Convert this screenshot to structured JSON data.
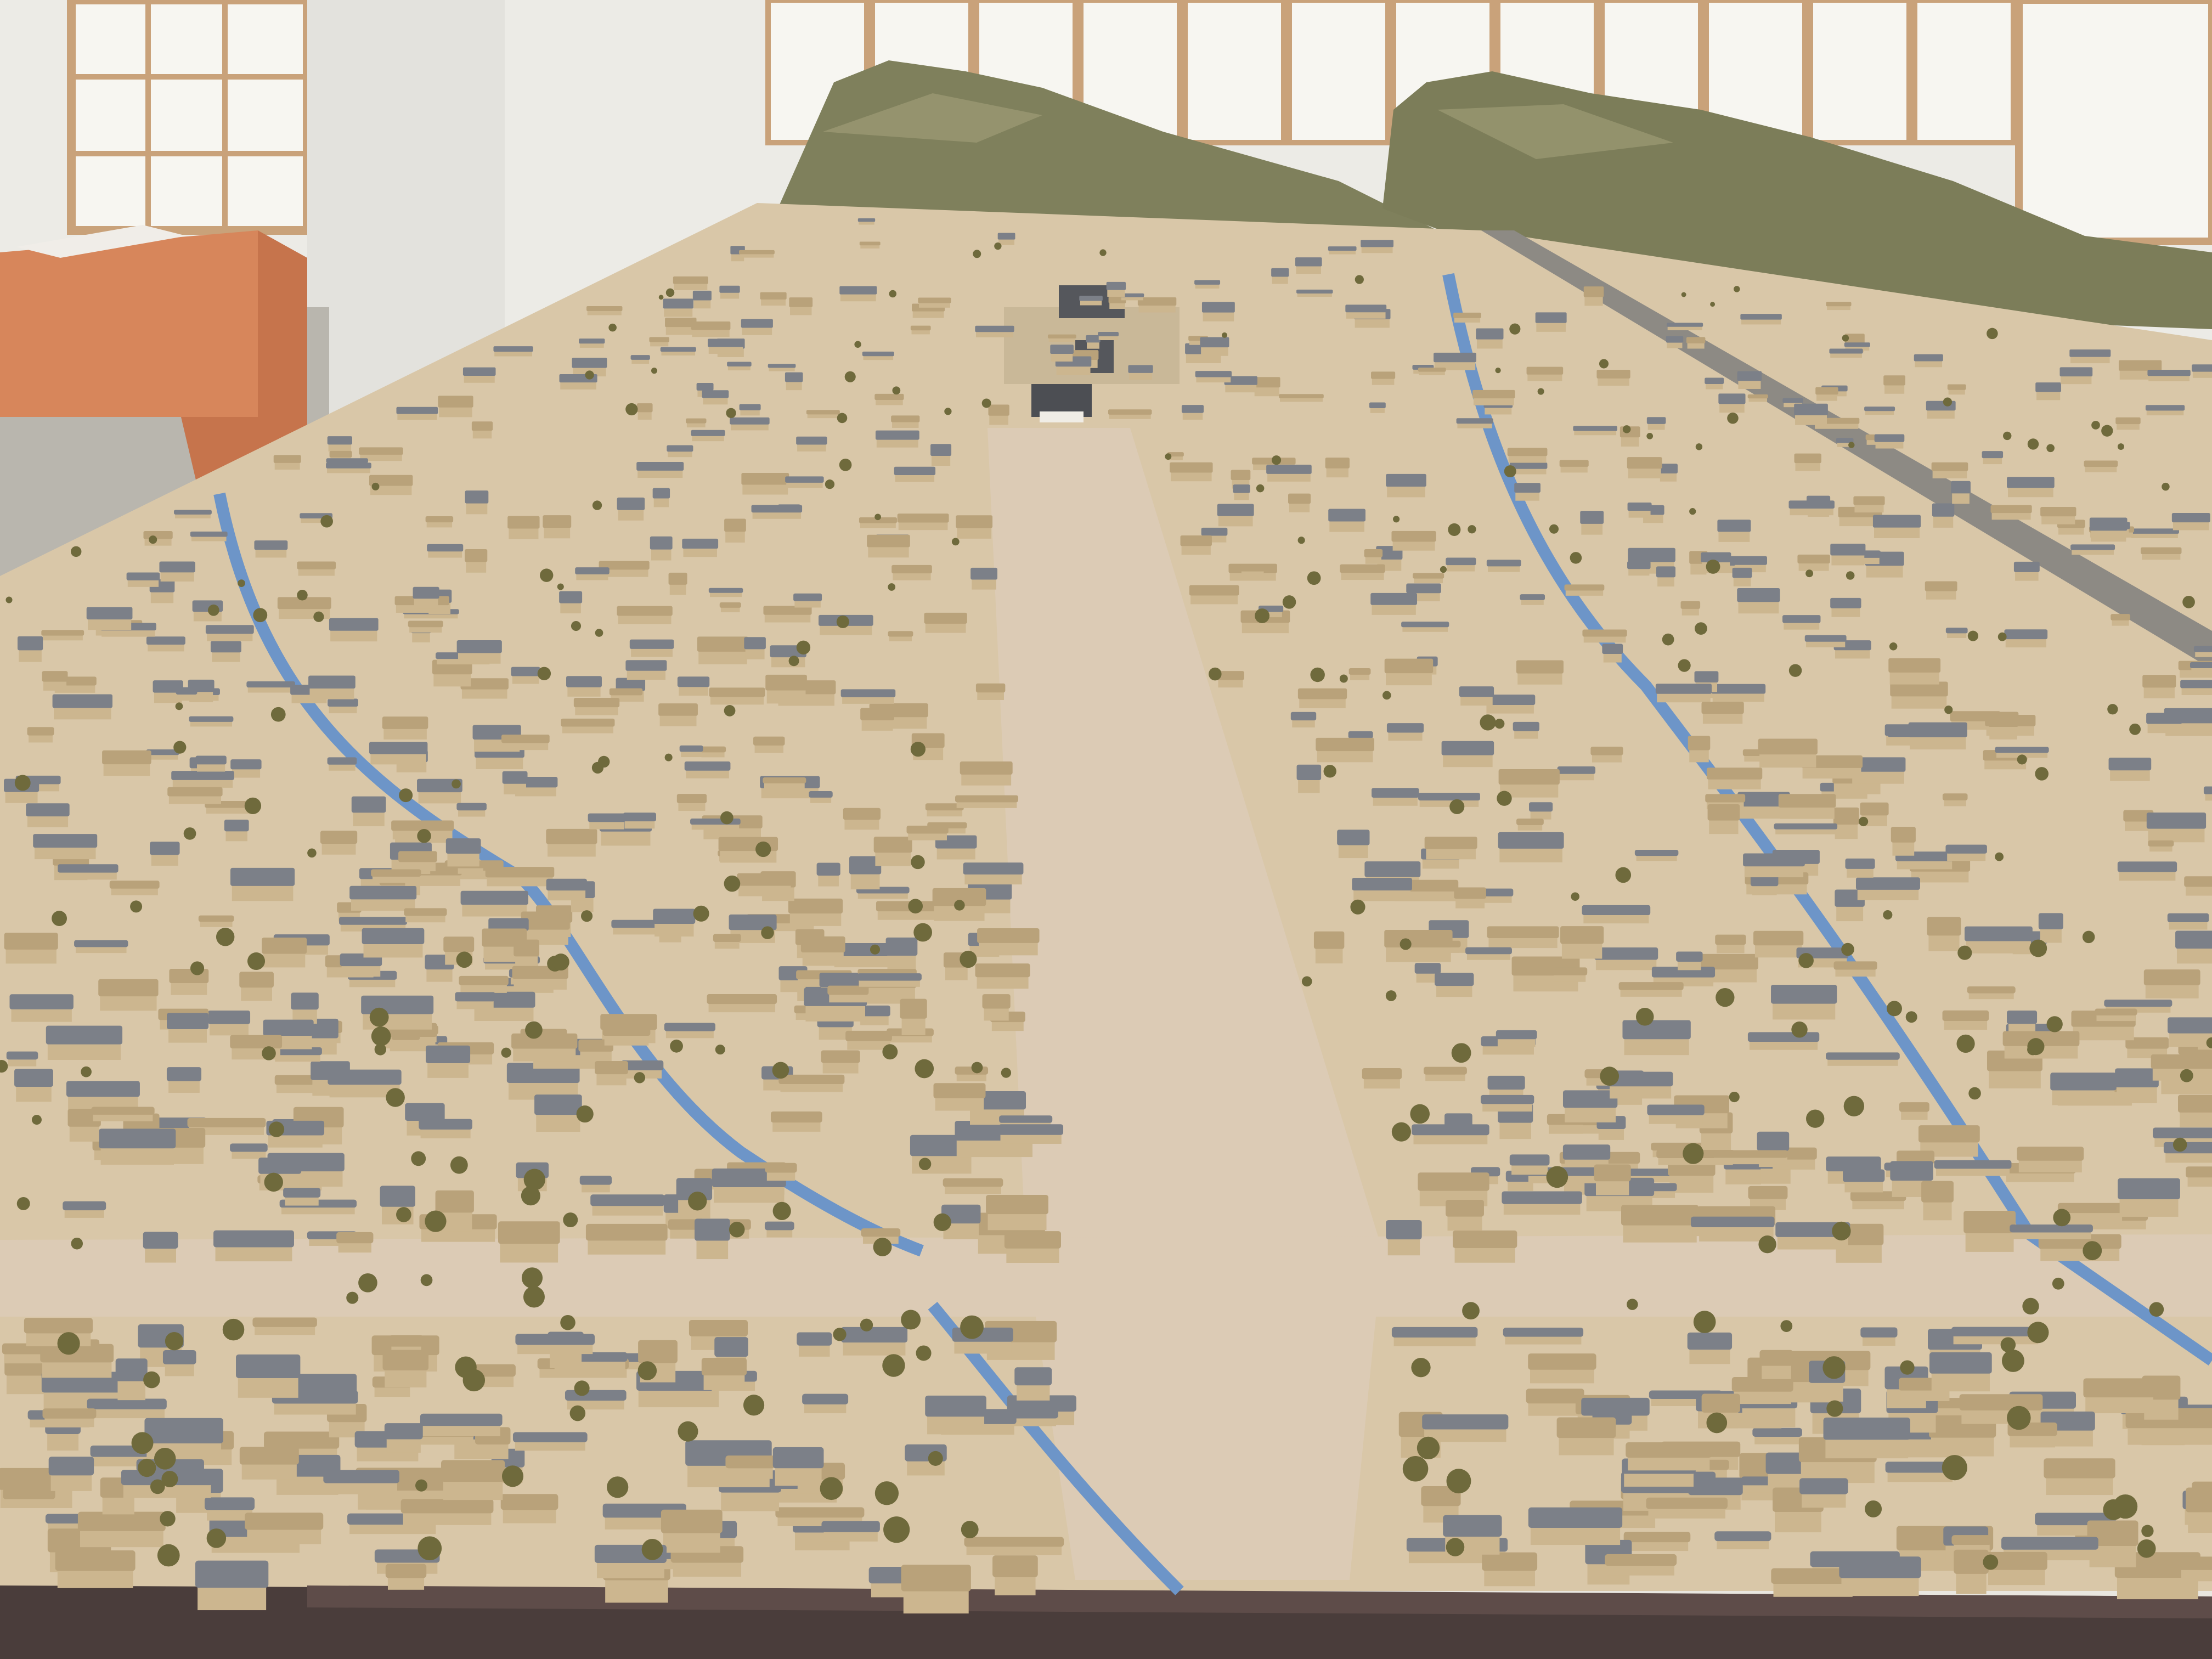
{
  "scene": {
    "colors": {
      "wall": "#ecebe6",
      "window_paper": "#f7f6f1",
      "window_frame": "#c9a27a",
      "floor": "#b9b6ae",
      "desk": "#d7865b",
      "desk_shadow": "#b8663f",
      "model_ground": "#d9c7a8",
      "main_road": "#d8c5ae",
      "roof_tile": "#7c8088",
      "roof_thatch": "#b9a27a",
      "wall_plaster": "#ccb68f",
      "stream": "#6d95c8",
      "tree": "#6f6a3c",
      "mountain": "#7f805c",
      "base_edge": "#4a3d3b"
    }
  }
}
